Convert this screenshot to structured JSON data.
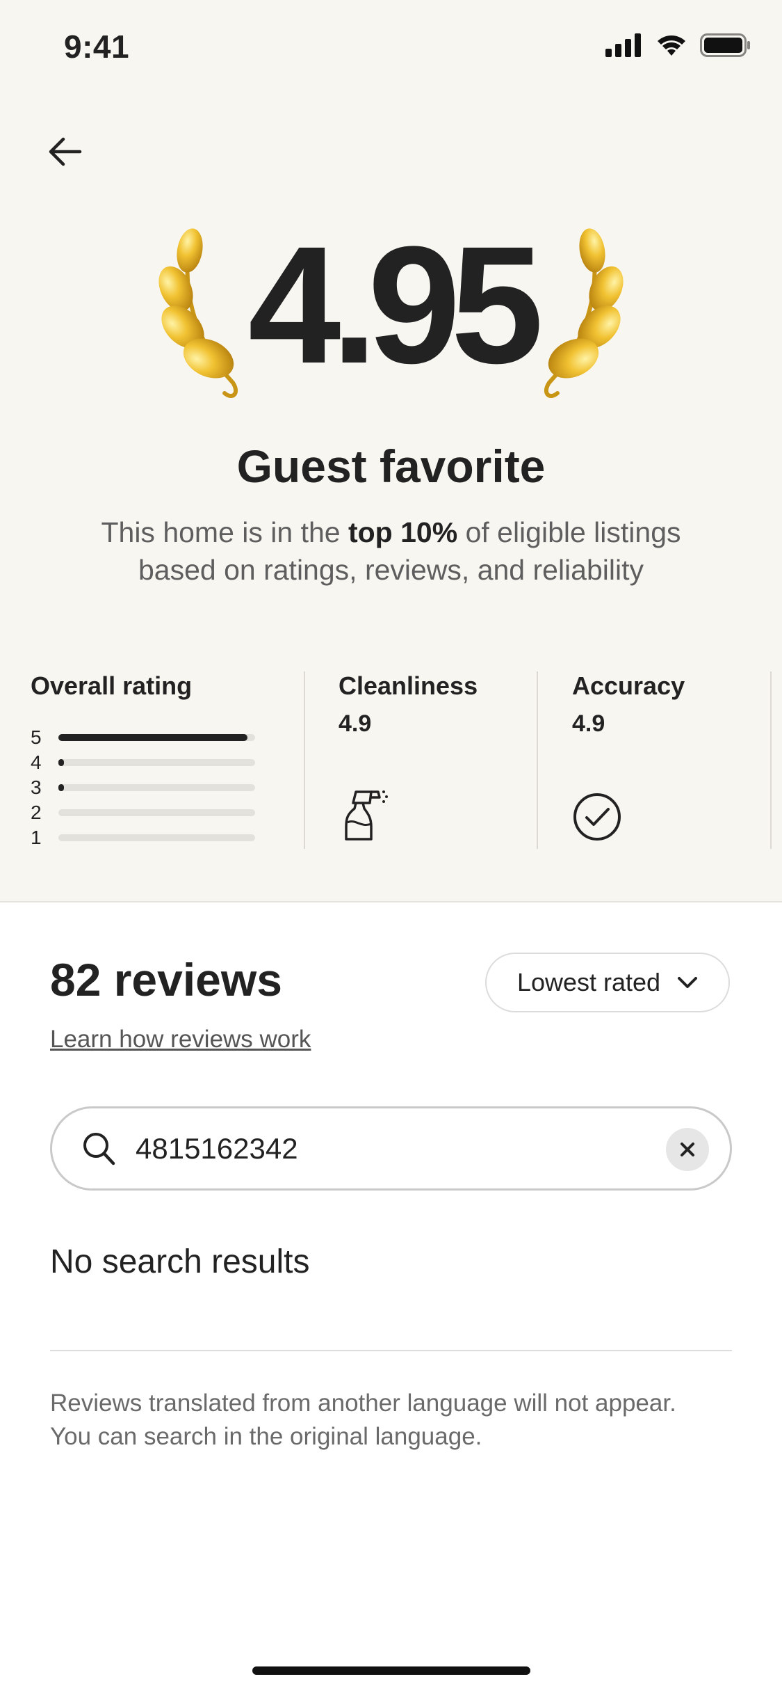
{
  "status_bar": {
    "time": "9:41"
  },
  "hero": {
    "rating": "4.95",
    "title": "Guest favorite",
    "desc_pre": "This home is in the ",
    "desc_bold": "top 10%",
    "desc_post": " of eligible listings based on ratings, reviews, and reliability"
  },
  "ratings": {
    "overall_label": "Overall rating",
    "distribution": [
      {
        "star": "5",
        "fraction": 0.96
      },
      {
        "star": "4",
        "fraction": 0.03
      },
      {
        "star": "3",
        "fraction": 0.01
      },
      {
        "star": "2",
        "fraction": 0.0
      },
      {
        "star": "1",
        "fraction": 0.0
      }
    ],
    "categories": [
      {
        "label": "Cleanliness",
        "value": "4.9",
        "icon": "spray-bottle-icon"
      },
      {
        "label": "Accuracy",
        "value": "4.9",
        "icon": "check-circle-icon"
      }
    ]
  },
  "reviews": {
    "count_label": "82 reviews",
    "learn_link": "Learn how reviews work",
    "sort_label": "Lowest rated",
    "search_value": "4815162342",
    "no_results": "No search results",
    "footnote_line1": "Reviews translated from another language will not appear.",
    "footnote_line2": "You can search in the original language."
  },
  "colors": {
    "hero_bg": "#f8f6f1",
    "laurel_gold": "#e5b523",
    "text": "#222222"
  }
}
